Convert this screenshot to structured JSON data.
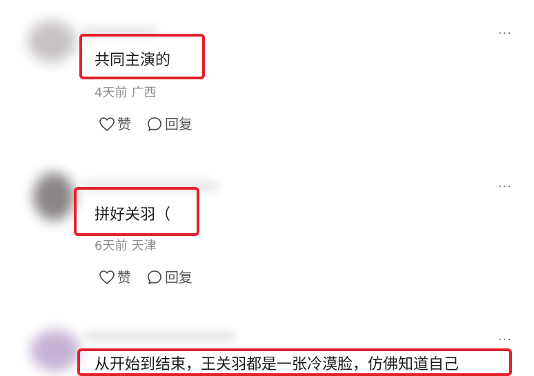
{
  "comments": [
    {
      "text": "共同主演的",
      "time": "4天前",
      "location": "广西",
      "like_label": "赞",
      "reply_label": "回复",
      "more_label": "···"
    },
    {
      "text": "拼好关羽（",
      "time": "6天前",
      "location": "天津",
      "like_label": "赞",
      "reply_label": "回复",
      "more_label": "···"
    },
    {
      "text": "从开始到结束，王关羽都是一张冷漠脸，仿佛知道自己",
      "more_label": "···"
    }
  ],
  "colors": {
    "highlight_border": "#e5202a",
    "meta_text": "#8d8d8d"
  }
}
